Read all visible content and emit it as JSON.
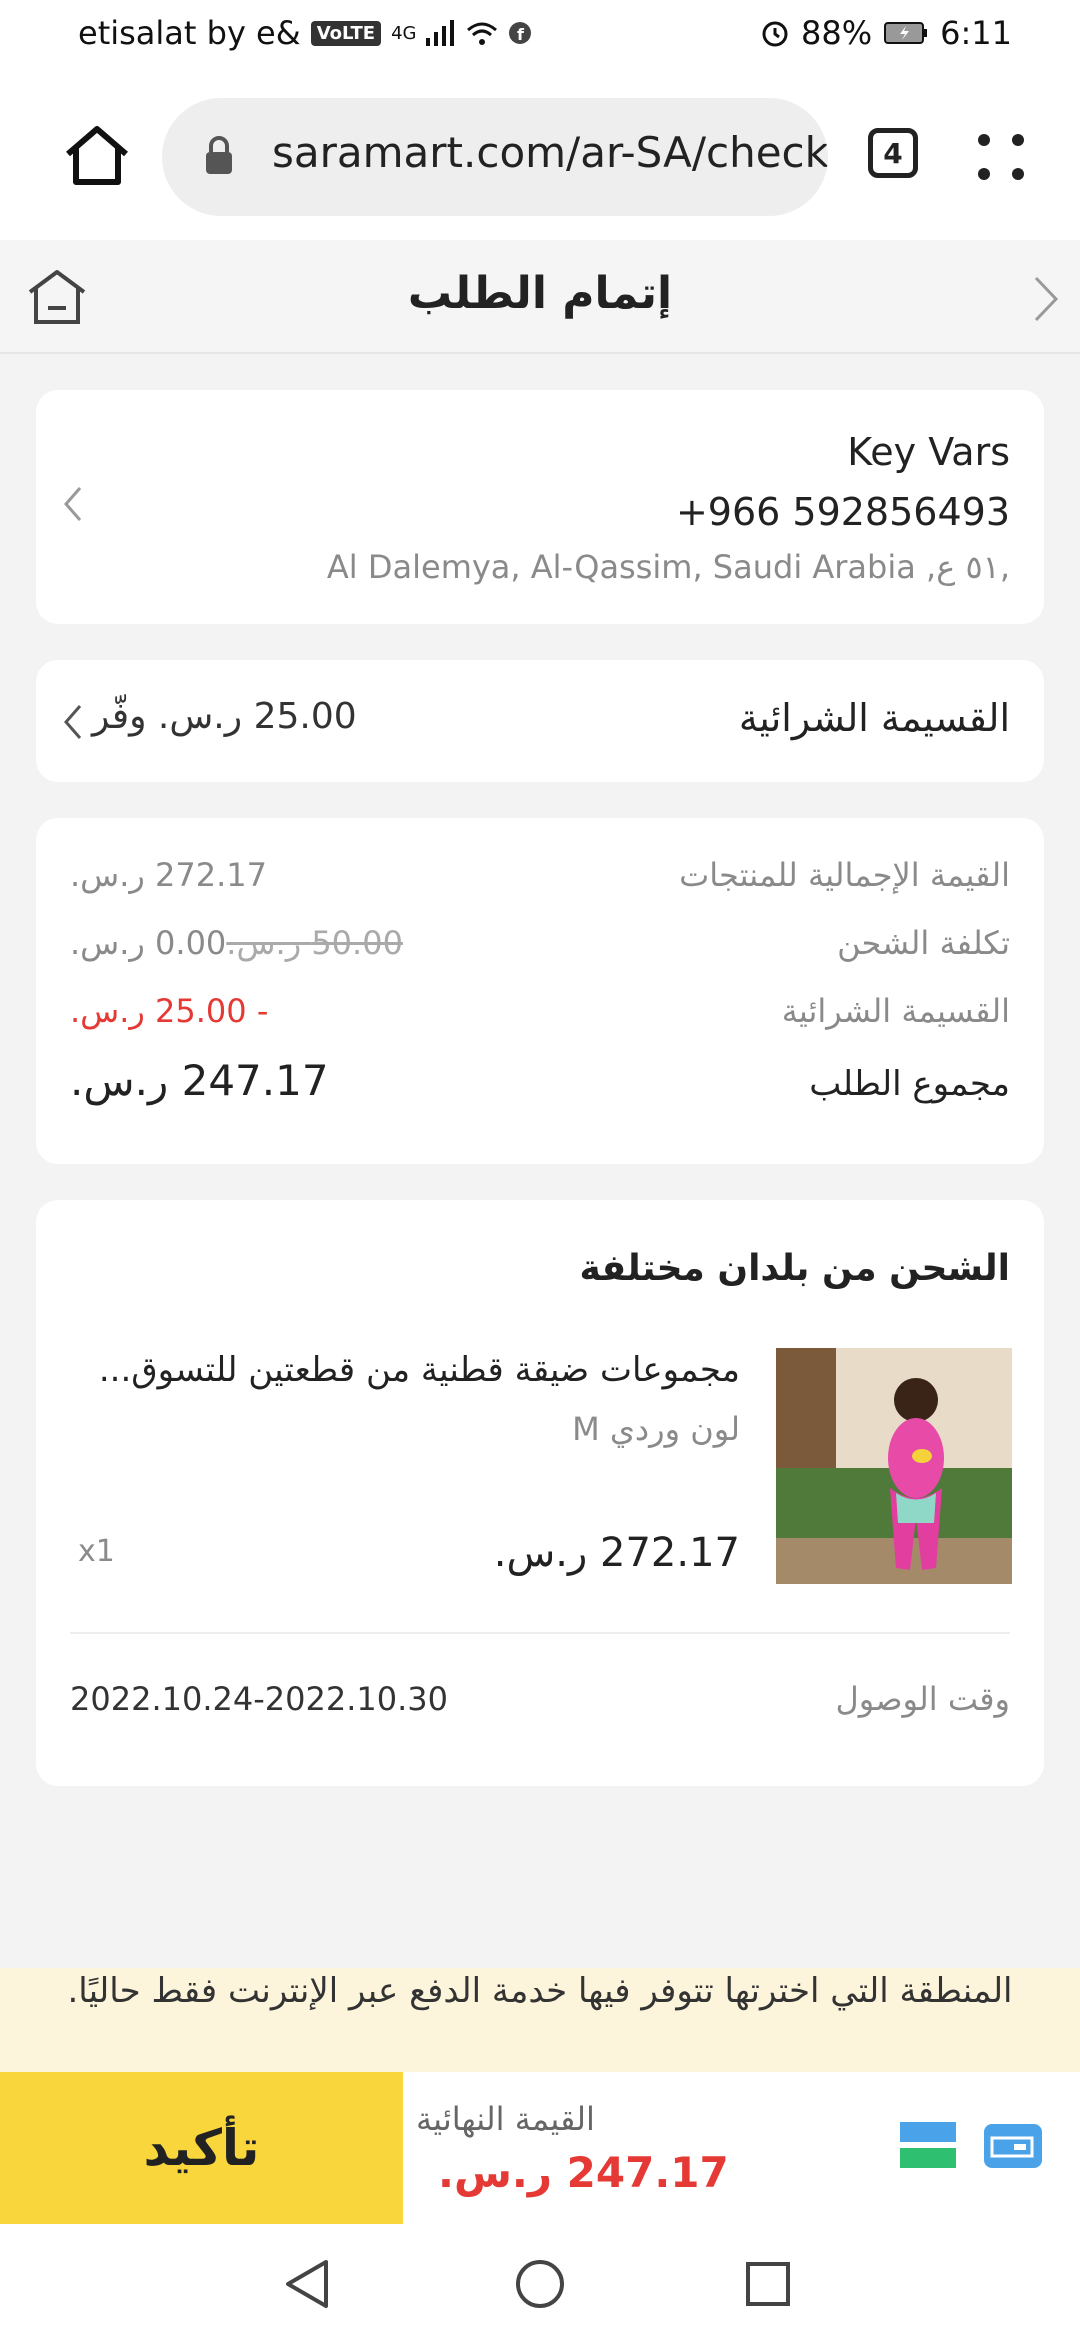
{
  "status_bar": {
    "carrier": "etisalat by e&",
    "volte": "VoLTE",
    "network": "4G",
    "battery": "88%",
    "time": "6:11"
  },
  "browser": {
    "url": "saramart.com/ar-SA/checkout",
    "tab_count": "4"
  },
  "page": {
    "title": "إتمام الطلب"
  },
  "address": {
    "name": "Key Vars",
    "phone": "+966 592856493",
    "line": "Al Dalemya, Al-Qassim, Saudi Arabia ,٥١ ع,"
  },
  "coupon": {
    "label": "القسيمة الشرائية",
    "value": "25.00 ر.س. وفّر"
  },
  "summary": {
    "rows": [
      {
        "label": "القيمة الإجمالية للمنتجات",
        "value": "272.17 ر.س."
      },
      {
        "label": "تكلفة الشحن",
        "old_value": "50.00 ر.س.",
        "value": "0.00 ر.س."
      },
      {
        "label": "القسيمة الشرائية",
        "value": "- 25.00 ر.س."
      }
    ],
    "total_label": "مجموع الطلب",
    "total_value": "247.17 ر.س."
  },
  "shipping": {
    "heading": "الشحن من بلدان مختلفة",
    "product_title": "مجموعات ضيقة قطنية من قطعتين للتسوق...",
    "variant": "لون وردي M",
    "price": "272.17 ر.س.",
    "qty": "x1",
    "arrival_label": "وقت الوصول",
    "arrival_dates": "2022.10.24-2022.10.30"
  },
  "notice": "المنطقة التي اخترتها تتوفر فيها خدمة الدفع عبر الإنترنت فقط حاليًا.",
  "bottom": {
    "confirm_label": "تأكيد",
    "final_label": "القيمة النهائية",
    "final_value": "247.17 ر.س."
  },
  "colors": {
    "accent_yellow": "#f9d63c",
    "price_red": "#e53935",
    "card_blue": "#4aa3e8",
    "bank_green": "#2fbf71"
  }
}
